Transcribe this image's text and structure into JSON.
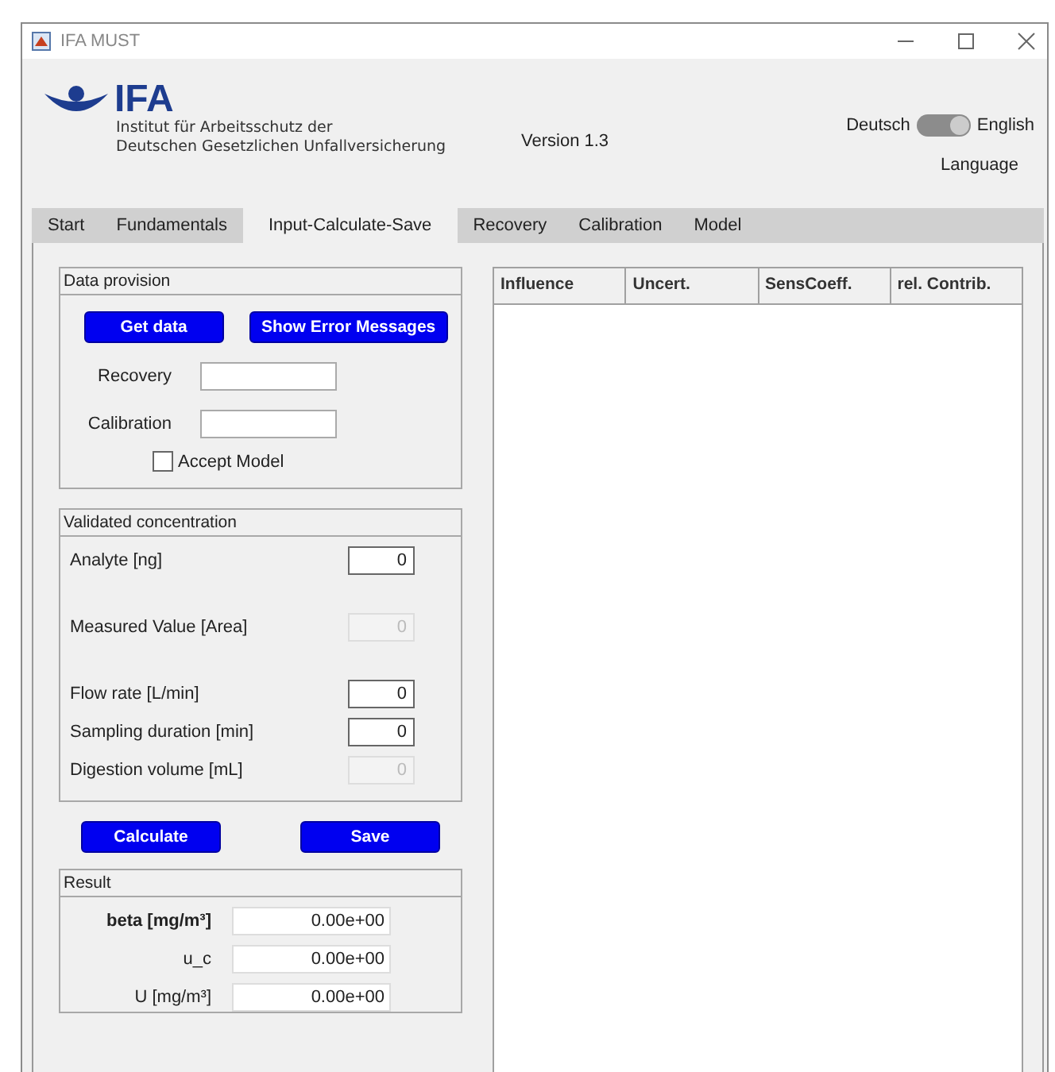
{
  "window": {
    "title": "IFA MUST"
  },
  "header": {
    "logo_text": "IFA",
    "institute_lines": [
      "Institut für Arbeitsschutz der",
      "Deutschen Gesetzlichen Unfallversicherung"
    ],
    "version": "Version 1.3",
    "language_toggle": {
      "left_label": "Deutsch",
      "right_label": "English",
      "on": true,
      "caption": "Language"
    }
  },
  "tabs": [
    {
      "label": "Start",
      "selected": false
    },
    {
      "label": "Fundamentals",
      "selected": false
    },
    {
      "label": "Input-Calculate-Save",
      "selected": true
    },
    {
      "label": "Recovery",
      "selected": false
    },
    {
      "label": "Calibration",
      "selected": false
    },
    {
      "label": "Model",
      "selected": false
    }
  ],
  "data_provision": {
    "title": "Data provision",
    "buttons": [
      "Get data",
      "Show Error Messages"
    ],
    "fields": [
      {
        "label": "Recovery"
      },
      {
        "label": "Calibration"
      }
    ],
    "checkbox": {
      "label": "Accept Model",
      "checked": false
    }
  },
  "validated_concentration": {
    "title": "Validated concentration",
    "fields": [
      {
        "label": "Analyte [ng]",
        "value": "0",
        "disabled": false
      },
      {
        "label": "Measured Value [Area]",
        "value": "0",
        "disabled": true
      },
      {
        "label": "Flow rate [L/min]",
        "value": "0",
        "disabled": false
      },
      {
        "label": "Sampling duration [min]",
        "value": "0",
        "disabled": false
      },
      {
        "label": "Digestion volume [mL]",
        "value": "0",
        "disabled": true
      }
    ]
  },
  "action_buttons": [
    "Calculate",
    "Save"
  ],
  "result": {
    "title": "Result",
    "fields": [
      {
        "label": "beta [mg/m³]",
        "value": "0.00e+00",
        "bold": true
      },
      {
        "label": "u_c",
        "value": "0.00e+00",
        "bold": false
      },
      {
        "label": "U [mg/m³]",
        "value": "0.00e+00",
        "bold": false
      }
    ]
  },
  "table": {
    "columns": [
      "Influence",
      "Uncert.",
      "SensCoeff.",
      "rel. Contrib."
    ]
  }
}
